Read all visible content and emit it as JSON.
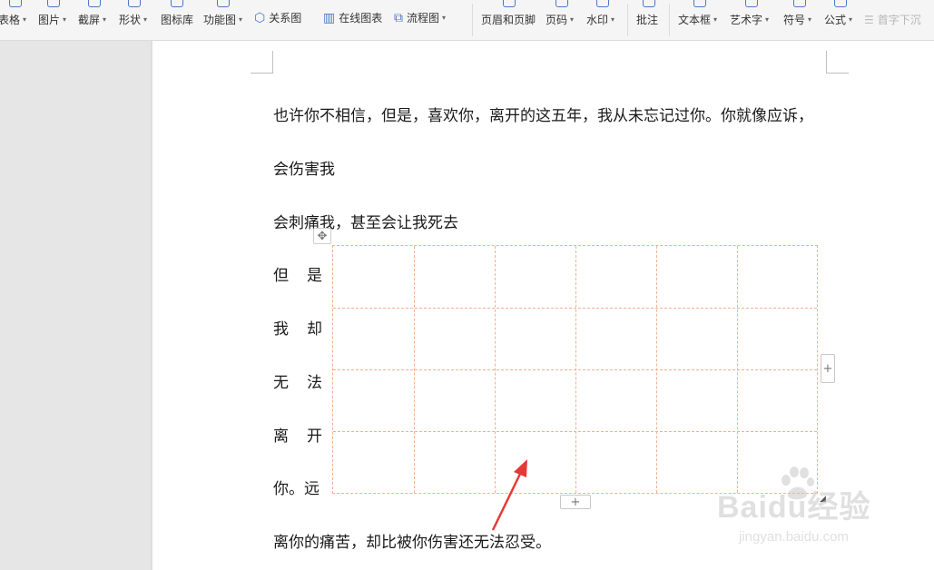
{
  "toolbar": {
    "items": [
      {
        "label": "表格",
        "has_dropdown": true
      },
      {
        "label": "图片",
        "has_dropdown": true
      },
      {
        "label": "截屏",
        "has_dropdown": true
      },
      {
        "label": "形状",
        "has_dropdown": true
      },
      {
        "label": "图标库",
        "has_dropdown": false
      },
      {
        "label": "功能图",
        "has_dropdown": true
      },
      {
        "label": "关系图",
        "has_dropdown": false
      },
      {
        "label": "在线图表",
        "has_dropdown": false
      },
      {
        "label": "流程图",
        "has_dropdown": true
      },
      {
        "label": "页眉和页脚",
        "has_dropdown": false
      },
      {
        "label": "页码",
        "has_dropdown": true
      },
      {
        "label": "水印",
        "has_dropdown": true
      },
      {
        "label": "批注",
        "has_dropdown": false
      },
      {
        "label": "文本框",
        "has_dropdown": true
      },
      {
        "label": "艺术字",
        "has_dropdown": true
      },
      {
        "label": "符号",
        "has_dropdown": true
      },
      {
        "label": "公式",
        "has_dropdown": true
      },
      {
        "label": "首字下沉",
        "has_dropdown": false,
        "disabled": true
      }
    ]
  },
  "document": {
    "para1": "也许你不相信，但是，喜欢你，离开的这五年，我从未忘记过你。你就像应诉，",
    "para2": "会伤害我",
    "para3": "会刺痛我，甚至会让我死去",
    "vertical_lines": [
      "但是",
      "我却",
      "无法",
      "离开",
      "你。远"
    ],
    "para_last": "离你的痛苦，却比被你伤害还无法忍受。",
    "table": {
      "rows": 4,
      "cols": 6
    }
  },
  "table_controls": {
    "move_handle": "✥",
    "add_column": "+",
    "add_row": "+"
  },
  "watermark": {
    "brand": "Baidu经验",
    "url": "jingyan.baidu.com"
  },
  "colors": {
    "table_border": "#f0b190",
    "arrow": "#e53935",
    "toolbar_bg": "#f5f5f5"
  }
}
